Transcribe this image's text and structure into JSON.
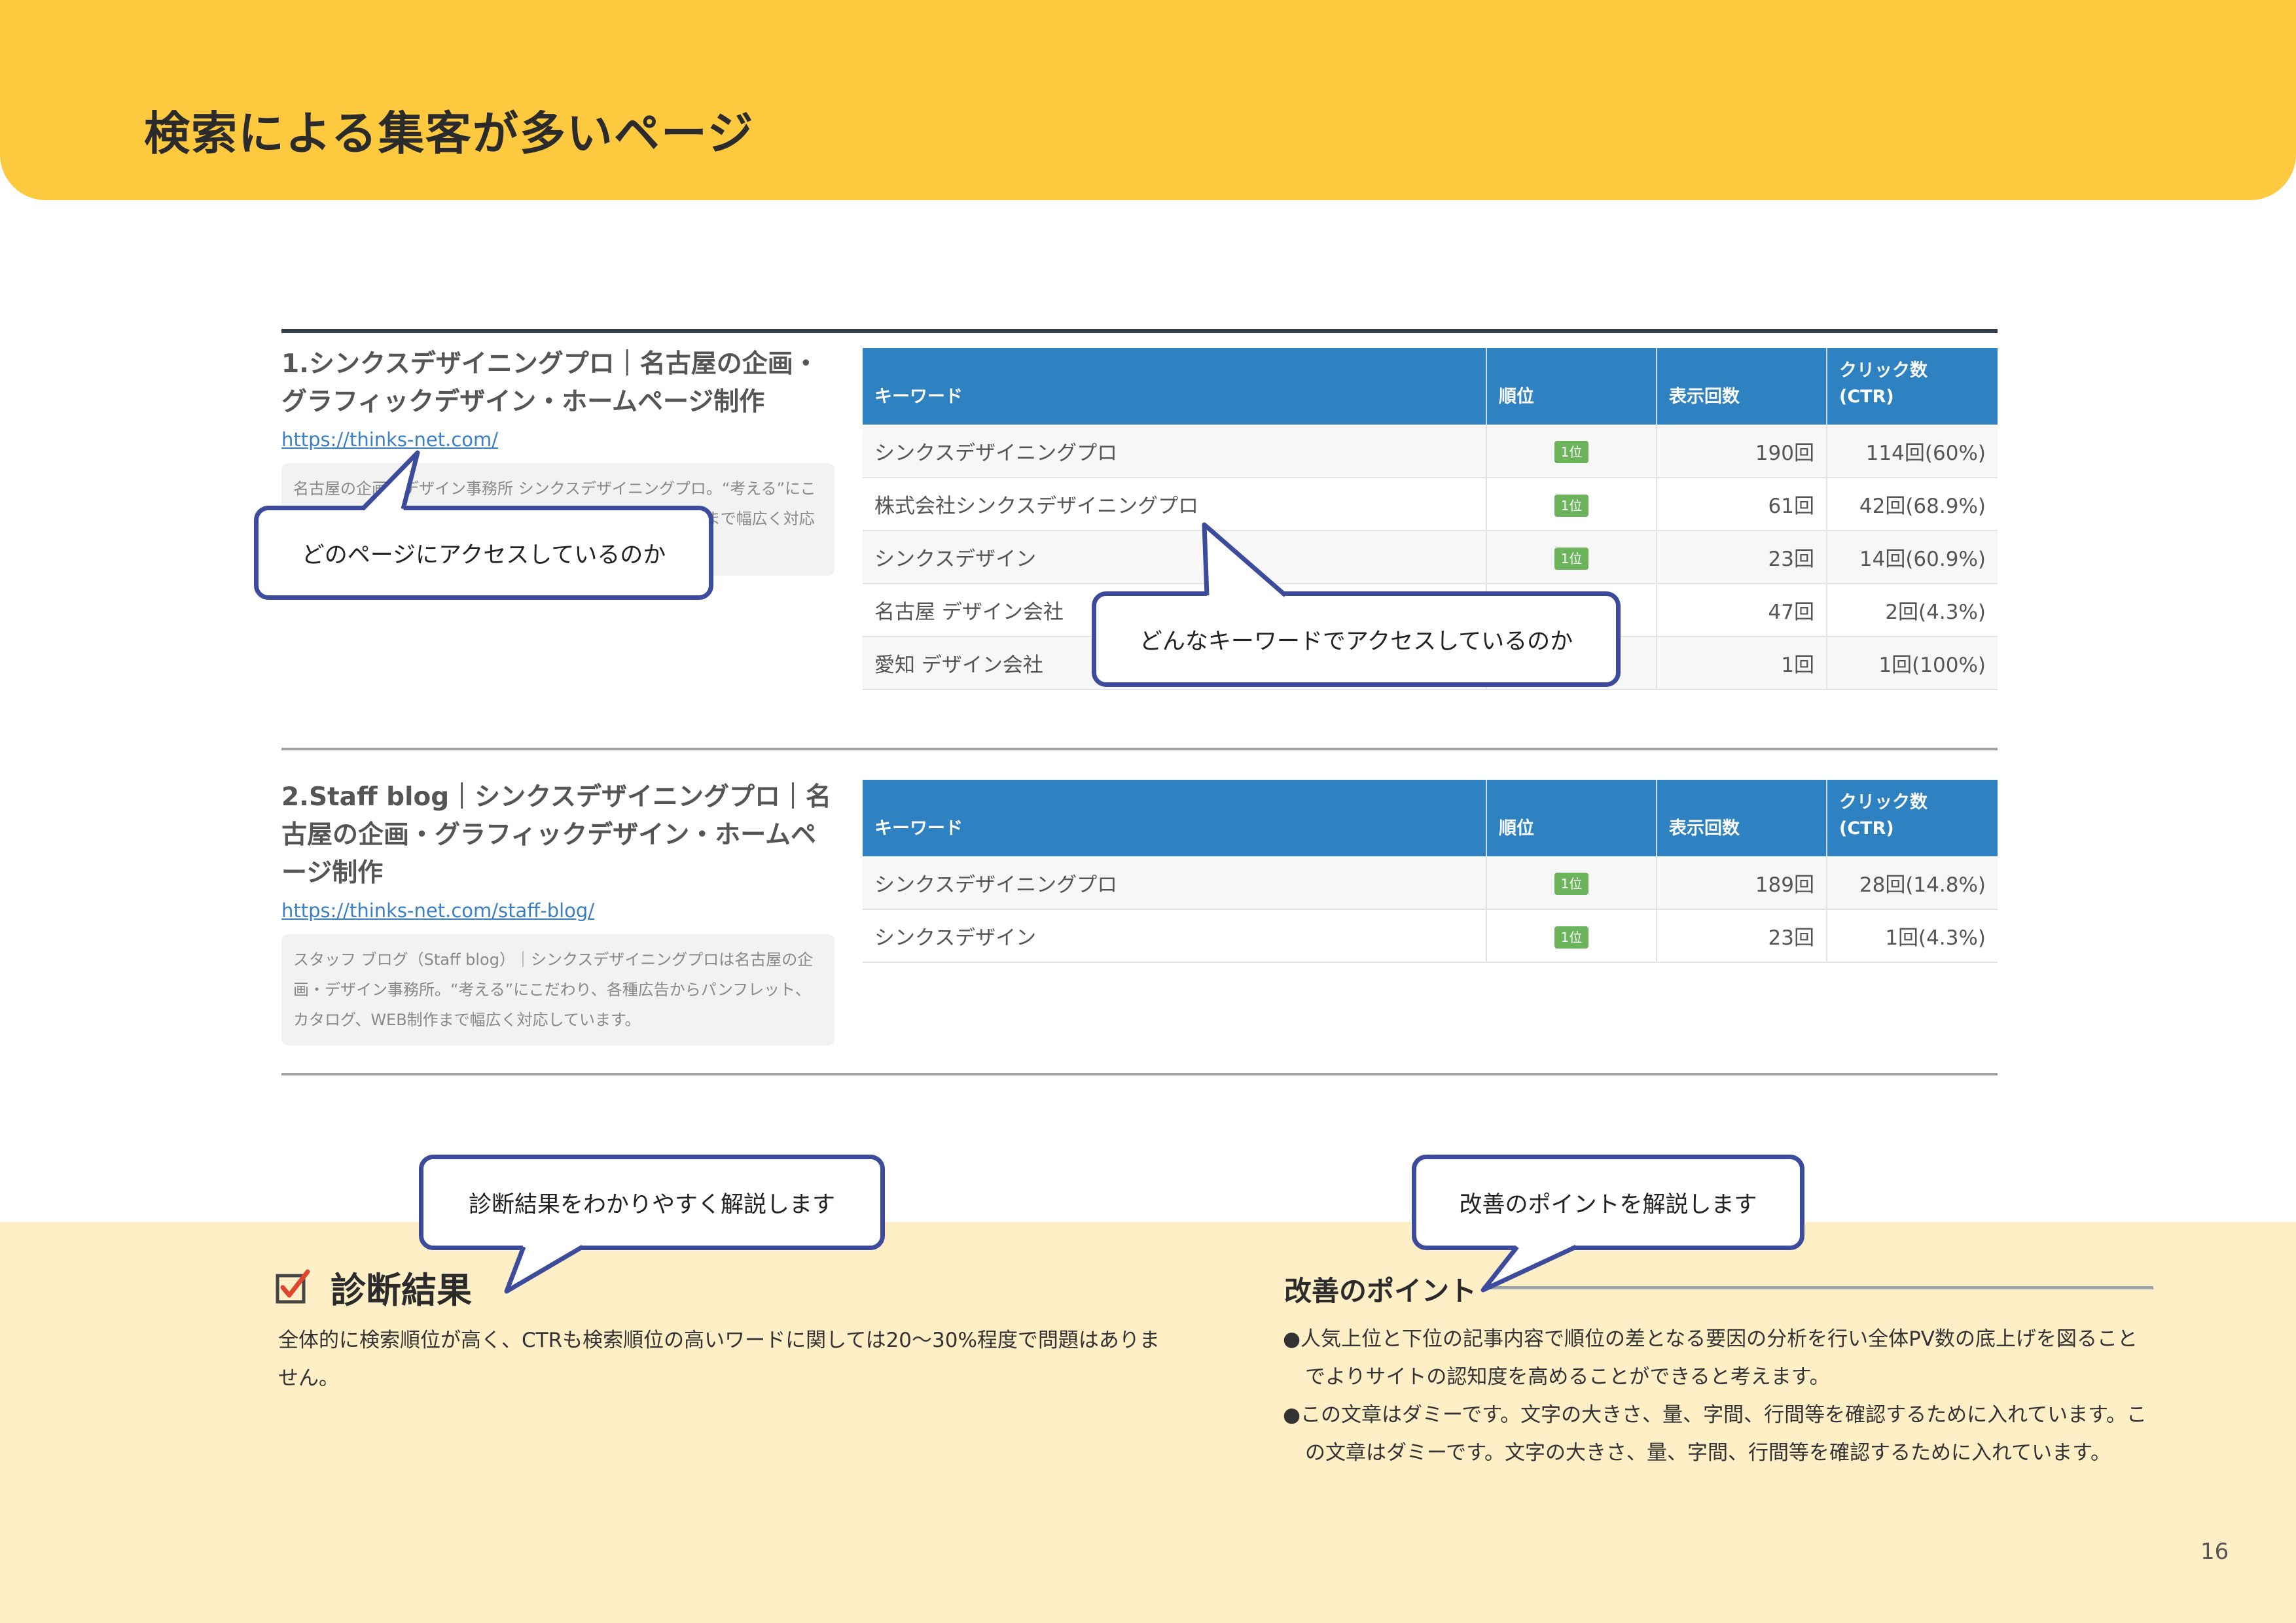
{
  "header": {
    "title": "検索による集客が多いページ"
  },
  "columns": {
    "keyword": "キーワード",
    "rank": "順位",
    "impressions": "表示回数",
    "clicks": "クリック数",
    "ctr": "(CTR)"
  },
  "pages": [
    {
      "heading": "1.シンクスデザイニングプロ｜名古屋の企画・グラフィックデザイン・ホームページ制作",
      "url": "https://thinks-net.com/",
      "description": "名古屋の企画・デザイン事務所 シンクスデザイニングプロ。“考える”にこだわり、各種広告からパンフレット、カタログ、WEB制作まで幅広く対応しています。",
      "rows": [
        {
          "keyword": "シンクスデザイニングプロ",
          "rank": "1位",
          "impressions": "190回",
          "clicks": "114回(60%)"
        },
        {
          "keyword": "株式会社シンクスデザイニングプロ",
          "rank": "1位",
          "impressions": "61回",
          "clicks": "42回(68.9%)"
        },
        {
          "keyword": "シンクスデザイン",
          "rank": "1位",
          "impressions": "23回",
          "clicks": "14回(60.9%)"
        },
        {
          "keyword": "名古屋 デザイン会社",
          "rank": "",
          "impressions": "47回",
          "clicks": "2回(4.3%)"
        },
        {
          "keyword": "愛知 デザイン会社",
          "rank": "",
          "impressions": "1回",
          "clicks": "1回(100%)"
        }
      ]
    },
    {
      "heading": "2.Staff blog｜シンクスデザイニングプロ｜名古屋の企画・グラフィックデザイン・ホームページ制作",
      "url": "https://thinks-net.com/staff-blog/",
      "description": "スタッフ ブログ（Staff blog）｜シンクスデザイニングプロは名古屋の企画・デザイン事務所。“考える”にこだわり、各種広告からパンフレット、カタログ、WEB制作まで幅広く対応しています。",
      "rows": [
        {
          "keyword": "シンクスデザイニングプロ",
          "rank": "1位",
          "impressions": "189回",
          "clicks": "28回(14.8%)"
        },
        {
          "keyword": "シンクスデザイン",
          "rank": "1位",
          "impressions": "23回",
          "clicks": "1回(4.3%)"
        }
      ]
    }
  ],
  "callouts": {
    "page_access": "どのページにアクセスしているのか",
    "keyword_access": "どんなキーワードでアクセスしているのか",
    "diagnosis_explain": "診断結果をわかりやすく解説します",
    "improvement_explain": "改善のポイントを解説します"
  },
  "diagnosis": {
    "icon": "checkbox-checked-icon",
    "title": "診断結果",
    "text": "全体的に検索順位が高く、CTRも検索順位の高いワードに関しては20〜30%程度で問題はありません。"
  },
  "improvement": {
    "title": "改善のポイント",
    "items": [
      "●人気上位と下位の記事内容で順位の差となる要因の分析を行い全体PV数の底上げを図ることでよりサイトの認知度を高めることができると考えます。",
      "●この文章はダミーです。文字の大きさ、量、字間、行間等を確認するために入れています。この文章はダミーです。文字の大きさ、量、字間、行間等を確認するために入れています。"
    ]
  },
  "footer": {
    "page_number": "16"
  },
  "colors": {
    "header": "#fdc93f",
    "table_header": "#2f82c2",
    "callout_border": "#3d4b9c",
    "rank_badge": "#6bb45c",
    "bottom_band": "#feefc6",
    "check": "#e0452e"
  }
}
